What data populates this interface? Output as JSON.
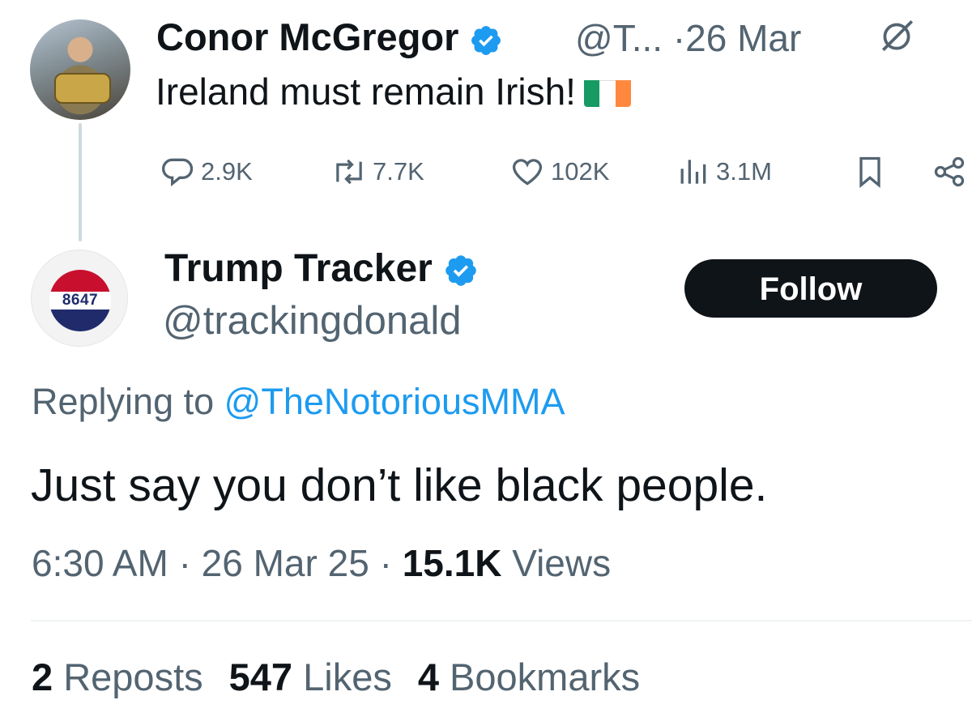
{
  "parent_tweet": {
    "author_name": "Conor McGregor",
    "handle_truncated": "@T...",
    "separator": "·",
    "date": "26 Mar",
    "text": "Ireland must remain Irish!",
    "flag_colors": [
      "#169b62",
      "#ffffff",
      "#ff883e"
    ],
    "actions": {
      "replies": "2.9K",
      "reposts": "7.7K",
      "likes": "102K",
      "views": "3.1M"
    },
    "icons": [
      "verified-badge-icon",
      "edit-history-icon",
      "reply-icon",
      "repost-icon",
      "like-icon",
      "views-icon",
      "bookmark-icon",
      "share-icon"
    ]
  },
  "reply_tweet": {
    "author_name": "Trump Tracker",
    "handle": "@trackingdonald",
    "avatar_text": "8647",
    "follow_label": "Follow",
    "replying_prefix": "Replying to",
    "replying_to": "@TheNotoriousMMA",
    "text": "Just say you don’t like black people.",
    "time": "6:30 AM",
    "date": "26 Mar 25",
    "views_count": "15.1K",
    "views_label": "Views",
    "dot": "·",
    "stats": {
      "reposts_count": "2",
      "reposts_label": "Reposts",
      "likes_count": "547",
      "likes_label": "Likes",
      "bookmarks_count": "4",
      "bookmarks_label": "Bookmarks"
    }
  },
  "colors": {
    "accent": "#1d9bf0",
    "text_primary": "#0f1419",
    "text_secondary": "#536471",
    "button_bg": "#0f1419"
  }
}
